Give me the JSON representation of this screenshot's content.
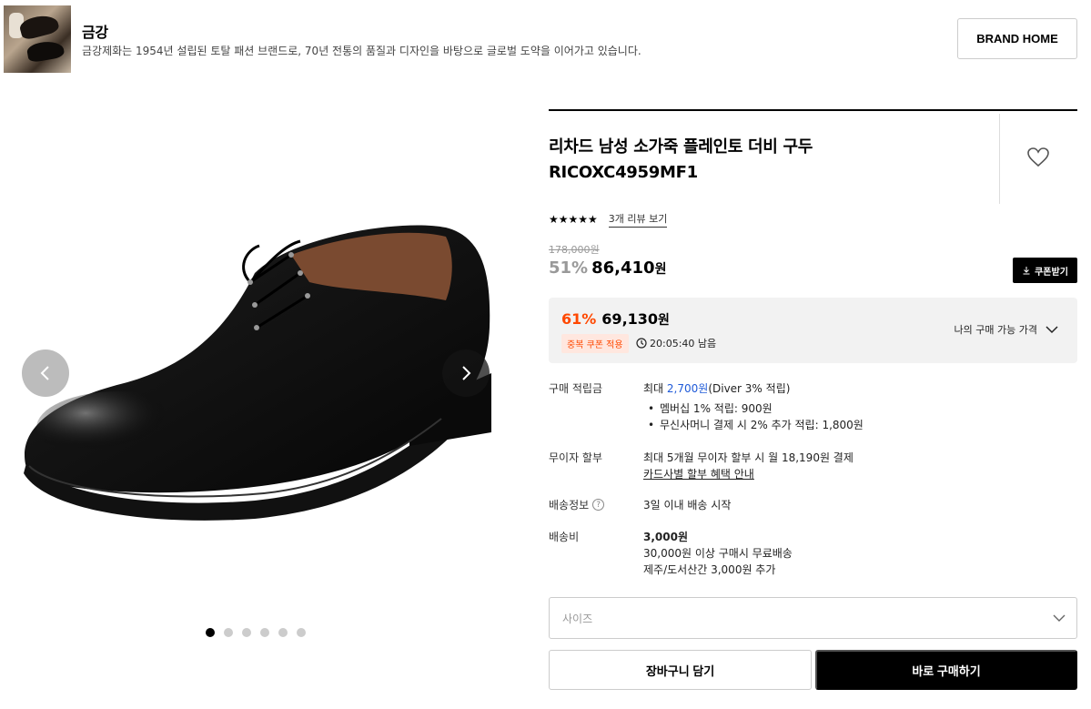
{
  "brand": {
    "name": "금강",
    "description": "금강제화는 1954년 설립된 토탈 패션 브랜드로, 70년 전통의 품질과 디자인을 바탕으로 글로벌 도약을 이어가고 있습니다.",
    "home_button": "BRAND HOME"
  },
  "gallery": {
    "slide_count": 6,
    "active_index": 0
  },
  "product": {
    "title_line1": "리차드 남성 소가죽 플레인토 더비 구두",
    "title_line2": "RICOXC4959MF1",
    "stars": "★★★★★",
    "rating": 5,
    "review_link": "3개 리뷰 보기",
    "original_price": "178,000원",
    "discount_pct": "51%",
    "sale_price": "86,410",
    "won": "원",
    "coupon_button": "쿠폰받기"
  },
  "my_price": {
    "pct": "61%",
    "price": "69,130",
    "won": "원",
    "badge": "중복 쿠폰 적용",
    "timer": "20:05:40 남음",
    "label": "나의 구매 가능 가격"
  },
  "details": {
    "points_label": "구매 적립금",
    "points_prefix": "최대 ",
    "points_amount": "2,700원",
    "points_suffix": "(Diver 3% 적립)",
    "points_bullet1": "멤버십 1% 적립: 900원",
    "points_bullet2": "무신사머니 결제 시 2% 추가 적립: 1,800원",
    "installment_label": "무이자 할부",
    "installment_value": "최대 5개월 무이자 할부 시 월 18,190원 결제",
    "installment_link": "카드사별 할부 혜택 안내",
    "shipping_info_label": "배송정보",
    "shipping_info_value": "3일 이내 배송 시작",
    "shipping_fee_label": "배송비",
    "shipping_fee_value": "3,000원",
    "shipping_free": "30,000원 이상 구매시 무료배송",
    "shipping_extra": "제주/도서산간 3,000원 추가"
  },
  "actions": {
    "size_placeholder": "사이즈",
    "cart_button": "장바구니 담기",
    "buy_button": "바로 구매하기"
  },
  "colors": {
    "accent_orange": "#ff4800",
    "link_blue": "#1f5ad8",
    "primary_black": "#000000"
  }
}
